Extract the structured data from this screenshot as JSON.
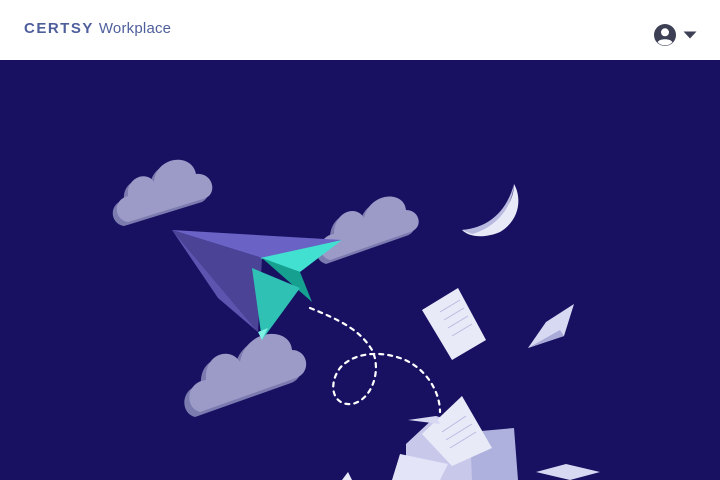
{
  "header": {
    "brand_name": "CERTSY",
    "product_name": "Workplace",
    "account_icon": "user-circle-icon",
    "account_caret_icon": "caret-down-icon"
  },
  "colors": {
    "header_bg": "#ffffff",
    "brand_text": "#4f5f9c",
    "hero_bg": "#181162",
    "cloud": "#9c9bc8",
    "plane_purple": "#5d54b0",
    "plane_teal": "#2fc1b4",
    "paper": "#e9eaf8"
  },
  "hero": {
    "illustration": "paper-plane-clouds-illustration"
  }
}
